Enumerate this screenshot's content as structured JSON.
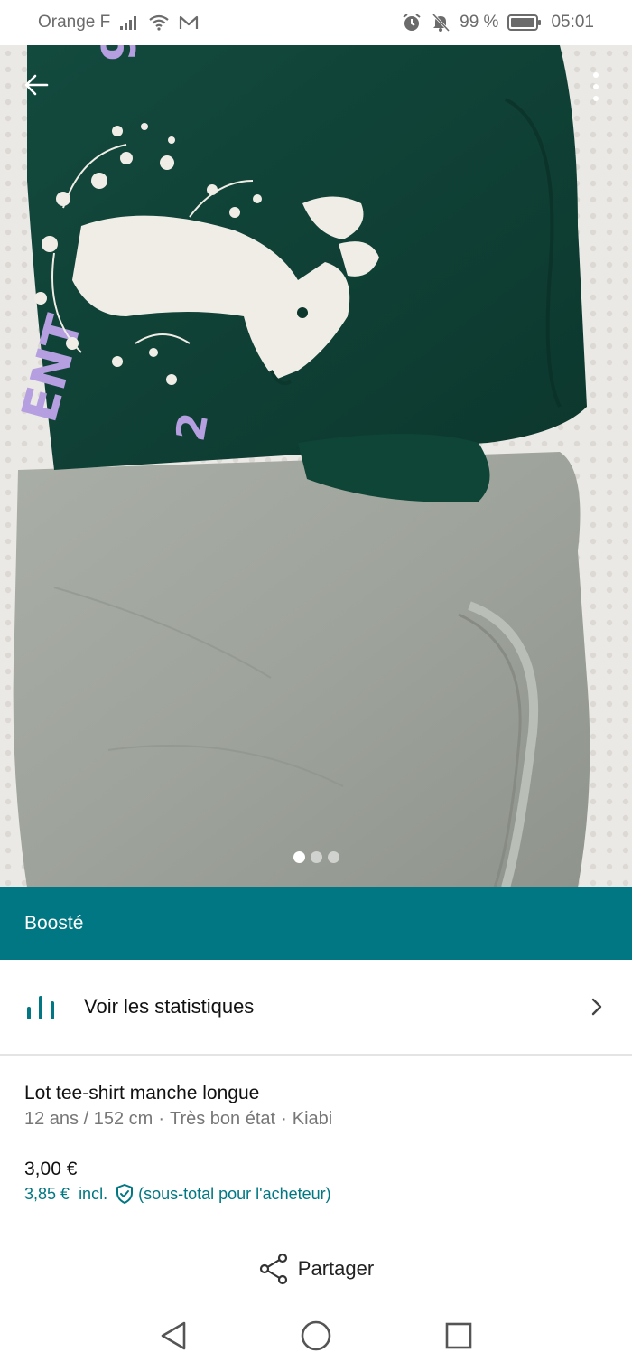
{
  "status_bar": {
    "carrier": "Orange F",
    "battery": "99 %",
    "time": "05:01",
    "icons": [
      "signal-icon",
      "wifi-icon",
      "mail-icon",
      "alarm-icon",
      "mute-icon",
      "battery-icon"
    ]
  },
  "photo": {
    "back_icon": "arrow-left-icon",
    "more_icon": "more-vertical-icon",
    "page_count": 3,
    "active_index": 0
  },
  "boost": {
    "label": "Boosté"
  },
  "stats": {
    "label": "Voir les statistiques",
    "icon": "bar-chart-icon"
  },
  "item": {
    "title": "Lot tee-shirt manche longue",
    "size": "12 ans / 152 cm",
    "condition": "Très bon état",
    "brand": "Kiabi",
    "price": "3,00 €",
    "price_incl": "3,85 €",
    "incl_label": "incl.",
    "subtotal_note": "(sous-total pour l'acheteur)"
  },
  "share": {
    "label": "Partager"
  },
  "colors": {
    "accent": "#007782"
  }
}
